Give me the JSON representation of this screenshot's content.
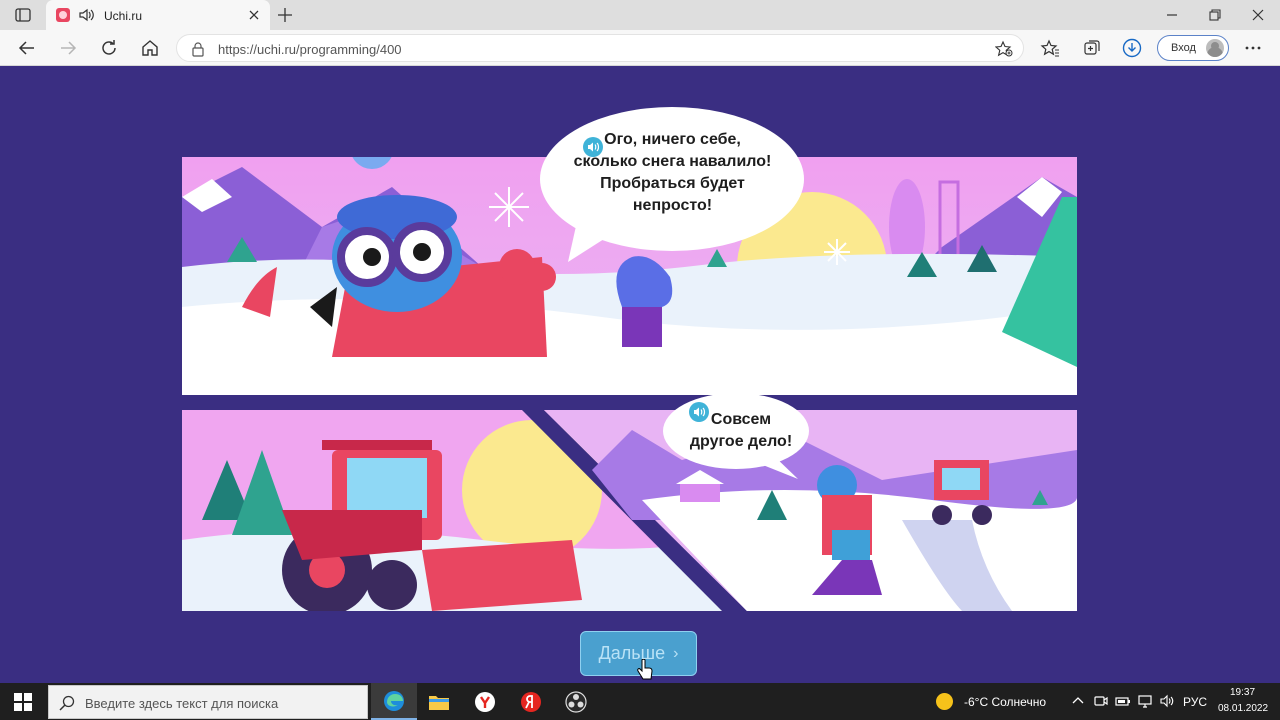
{
  "browser": {
    "tab_title": "Uchi.ru",
    "url": "https://uchi.ru/programming/400",
    "signin_label": "Вход"
  },
  "comic": {
    "bubble1": "Ого, ничего себе,\nсколько снега навалило!\nПробраться будет\nнепросто!",
    "bubble2": "Совсем\nдругое дело!"
  },
  "next_button": {
    "label": "Дальше",
    "chevron": "›"
  },
  "taskbar": {
    "search_placeholder": "Введите здесь текст для поиска",
    "weather": "-6°C  Солнечно",
    "language": "РУС",
    "time": "19:37",
    "date": "08.01.2022"
  },
  "colors": {
    "page_background": "#3a2e82",
    "button": "#4aa0cf",
    "accent": "#3fb3d8",
    "excavator": "#e94661"
  }
}
